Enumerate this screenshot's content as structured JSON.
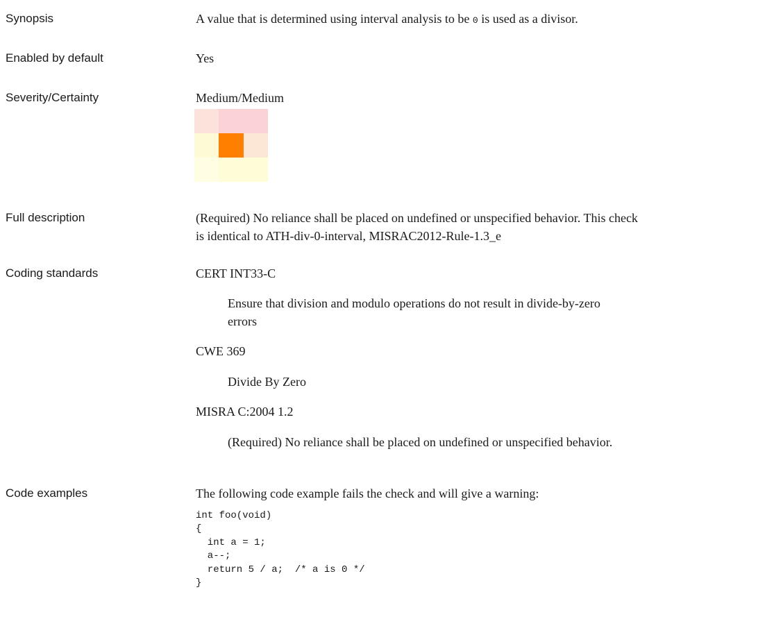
{
  "synopsis": {
    "label": "Synopsis",
    "text_before": "A value that is determined using interval analysis to be ",
    "code": "0",
    "text_after": " is used as a divisor."
  },
  "enabled": {
    "label": "Enabled by default",
    "value": "Yes"
  },
  "severity": {
    "label": "Severity/Certainty",
    "value": "Medium/Medium",
    "matrix_colors": [
      [
        "#fbe3dc",
        "#fbd2d6",
        "#fbd3d7"
      ],
      [
        "#fffad6",
        "#ff7f00",
        "#fce7d6"
      ],
      [
        "#fffde2",
        "#fffdd8",
        "#fffcd8"
      ]
    ]
  },
  "full_description": {
    "label": "Full description",
    "line1": "(Required) No reliance shall be placed on undefined or unspecified behavior. This check",
    "line2": "is identical to ATH-div-0-interval, MISRAC2012-Rule-1.3_e"
  },
  "coding_standards": {
    "label": "Coding standards",
    "items": [
      {
        "name": "CERT INT33-C",
        "desc_line1": "Ensure that division and modulo operations do not result in divide-by-zero",
        "desc_line2": "errors"
      },
      {
        "name": "CWE 369",
        "desc_line1": "Divide By Zero"
      },
      {
        "name": "MISRA C:2004 1.2",
        "desc_line1": "(Required) No reliance shall be placed on undefined or unspecified behavior."
      }
    ]
  },
  "code_examples": {
    "label": "Code examples",
    "intro": "The following code example fails the check and will give a warning:",
    "code": "int foo(void)\n{\n  int a = 1;\n  a--;\n  return 5 / a;  /* a is 0 */\n}"
  }
}
